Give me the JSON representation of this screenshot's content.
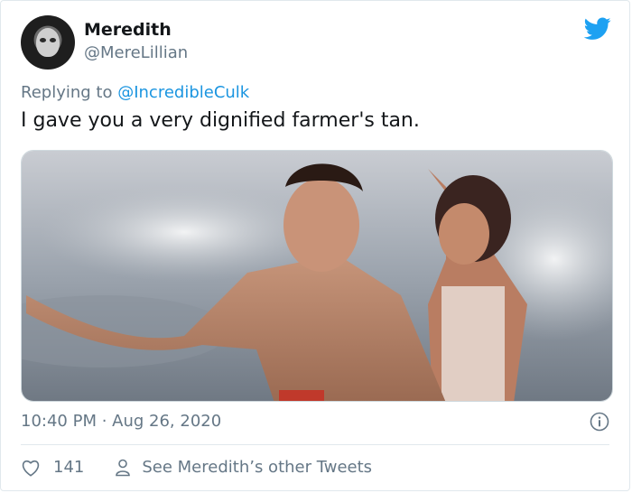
{
  "author": {
    "name": "Meredith",
    "handle": "@MereLillian"
  },
  "reply": {
    "prefix": "Replying to ",
    "mention": "@IncredibleCulk"
  },
  "tweet": {
    "text": "I gave you a very dignified farmer's tan."
  },
  "meta": {
    "timestamp": "10:40 PM · Aug 26, 2020"
  },
  "actions": {
    "like_count": "141",
    "other_tweets_label": "See Meredith’s other Tweets"
  },
  "colors": {
    "twitter_blue": "#1da1f2",
    "mention_blue": "#1b95e0",
    "secondary_text": "#657786"
  },
  "icons": [
    "twitter-bird-icon",
    "info-icon",
    "heart-icon",
    "person-icon"
  ]
}
